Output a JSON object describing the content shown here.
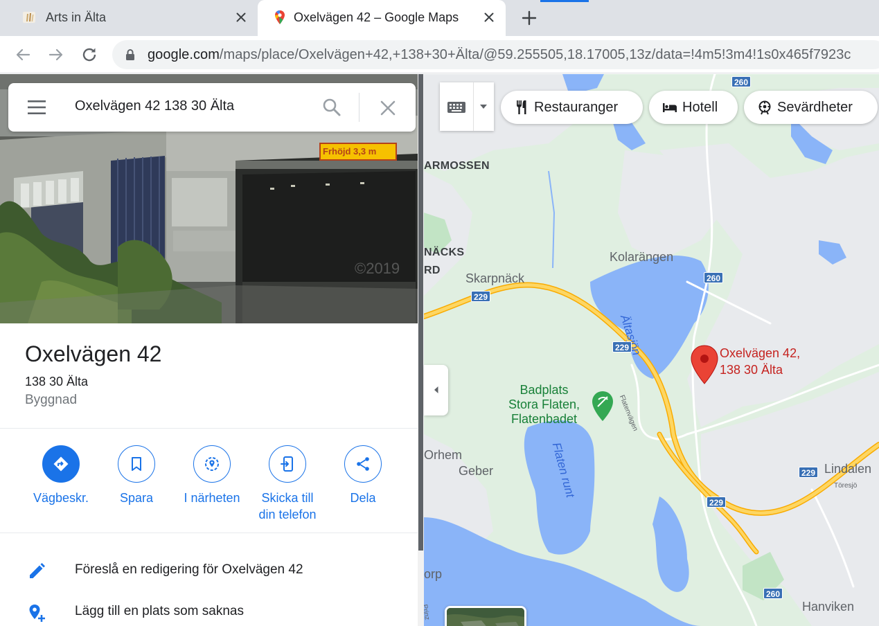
{
  "browser": {
    "tabs": [
      {
        "title": "Arts in Älta",
        "favicon": "paintbrush-icon",
        "active": false
      },
      {
        "title": "Oxelvägen 42 – Google Maps",
        "favicon": "maps-pin-icon",
        "active": true
      }
    ],
    "url_host": "google.com",
    "url_path": "/maps/place/Oxelvägen+42,+138+30+Älta/@59.255505,18.17005,13z/data=!4m5!3m4!1s0x465f7923c"
  },
  "search": {
    "value": "Oxelvägen 42 138 30 Älta"
  },
  "place": {
    "title": "Oxelvägen 42",
    "address": "138 30 Älta",
    "type": "Byggnad",
    "photo_sign_text": "Frhöjd 3,3 m",
    "photo_watermark": "©2019"
  },
  "actions": [
    {
      "label": "Vägbeskr.",
      "icon": "directions-icon"
    },
    {
      "label": "Spara",
      "icon": "bookmark-icon"
    },
    {
      "label": "I närheten",
      "icon": "nearby-icon"
    },
    {
      "label": "Skicka till\ndin telefon",
      "icon": "send-to-phone-icon"
    },
    {
      "label": "Dela",
      "icon": "share-icon"
    }
  ],
  "list_items": [
    {
      "label": "Föreslå en redigering för Oxelvägen 42",
      "icon": "pencil-icon"
    },
    {
      "label": "Lägg till en plats som saknas",
      "icon": "add-place-icon"
    }
  ],
  "map": {
    "chips": [
      {
        "label": "Restauranger",
        "icon": "fork-knife-icon"
      },
      {
        "label": "Hotell",
        "icon": "bed-icon"
      },
      {
        "label": "Sevärdheter",
        "icon": "attraction-icon"
      }
    ],
    "labels": {
      "armossen": "ARMOSSEN",
      "nacks": "NÄCKS",
      "rd": "RD",
      "kolarangen": "Kolarängen",
      "skarpnack": "Skarpnäck",
      "altasjon": "Ältasjön",
      "orhem": "Orhem",
      "geber": "Geber",
      "flaten_runt": "Flaten runt",
      "flatenvagen": "Flatenvägen",
      "lindalen": "Lindalen",
      "foresjo": "Töresjö",
      "hanviken": "Hanviken",
      "torp": "orp",
      "prinz": "Prinz"
    },
    "poi": "Badplats\nStora Flaten,\nFlatenbadet",
    "pin_label": "Oxelvägen 42,\n138 30 Älta",
    "shields": {
      "s260a": "260",
      "s260b": "260",
      "s260c": "260",
      "s229a": "229",
      "s229b": "229",
      "s229c": "229",
      "s229d": "229"
    },
    "colors": {
      "land": "#e0efe1",
      "urban": "#e8eaed",
      "water": "#8ab4f8",
      "highway": "#fdd663",
      "pin": "#ea4335"
    }
  }
}
